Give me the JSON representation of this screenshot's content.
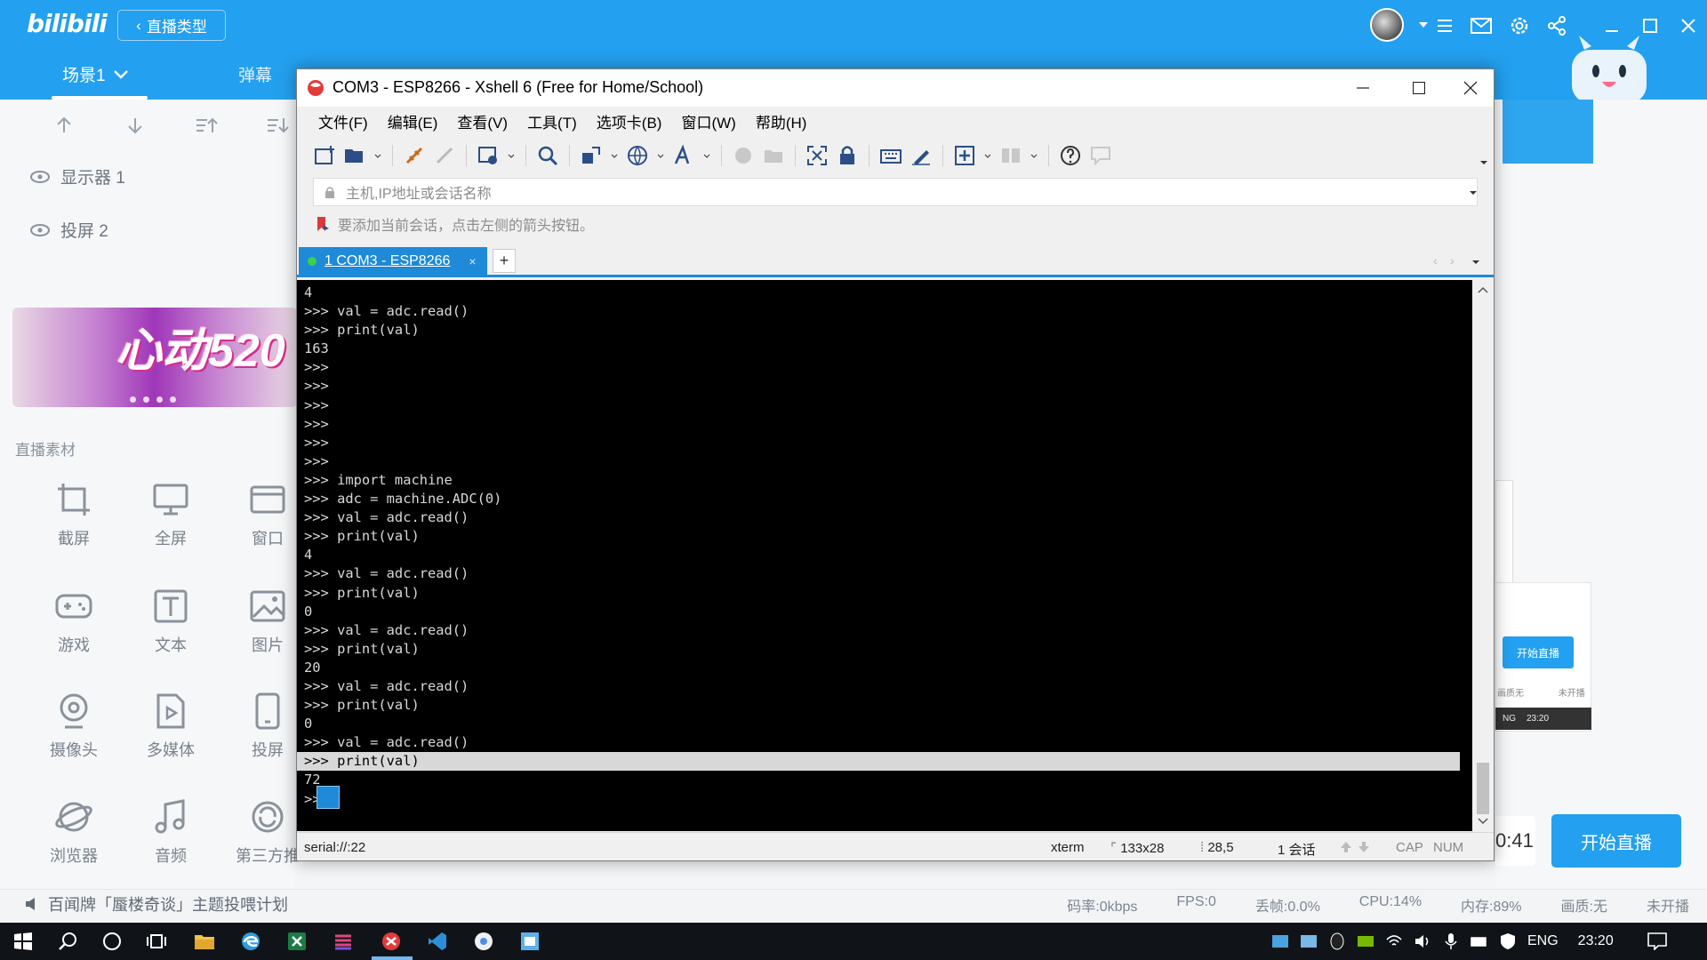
{
  "bili": {
    "logo": "bilibili",
    "live_type": "直播类型",
    "scene_tab": "场景1",
    "danmu_tab": "弹幕",
    "sources": [
      "显示器 1",
      "投屏 2"
    ],
    "banner_text": "心动520",
    "live_material_title": "直播素材",
    "materials": [
      "截屏",
      "全屏",
      "窗口",
      "游戏",
      "文本",
      "图片",
      "摄像头",
      "多媒体",
      "投屏",
      "浏览器",
      "音频",
      "第三方推"
    ],
    "timer": "0:41",
    "start_live": "开始直播",
    "mini_start_live": "开始直播",
    "mini_status": [
      "画质无",
      "未开播"
    ],
    "mini_bar": [
      "NG",
      "23:20"
    ],
    "notice": "百闻牌「蜃楼奇谈」主题投喂计划",
    "stats": [
      "码率:0kbps",
      "FPS:0",
      "丢帧:0.0%",
      "CPU:14%",
      "内存:89%",
      "画质:无",
      "未开播"
    ]
  },
  "xshell": {
    "title": "COM3 - ESP8266 - Xshell 6 (Free for Home/School)",
    "menu": [
      "文件(F)",
      "编辑(E)",
      "查看(V)",
      "工具(T)",
      "选项卡(B)",
      "窗口(W)",
      "帮助(H)"
    ],
    "address_placeholder": "主机,IP地址或会话名称",
    "hint": "要添加当前会话，点击左侧的箭头按钮。",
    "tab_label": "1 COM3 - ESP8266",
    "terminal_lines": [
      "4",
      ">>> val = adc.read()",
      ">>> print(val)",
      "163",
      ">>>",
      ">>>",
      ">>>",
      ">>>",
      ">>>",
      ">>>",
      ">>> import machine",
      ">>> adc = machine.ADC(0)",
      ">>> val = adc.read()",
      ">>> print(val)",
      "4",
      ">>> val = adc.read()",
      ">>> print(val)",
      "0",
      ">>> val = adc.read()",
      ">>> print(val)",
      "20",
      ">>> val = adc.read()",
      ">>> print(val)",
      "0",
      ">>> val = adc.read()"
    ],
    "highlight_line": ">>> print(val)",
    "after_lines": [
      "72",
      ">>"
    ],
    "status": {
      "connection": "serial://:22",
      "term_type": "xterm",
      "size": "133x28",
      "cursor_pos": "28,5",
      "sessions": "1 会话",
      "caps": "CAP",
      "num": "NUM"
    }
  },
  "taskbar": {
    "lang": "ENG",
    "clock": "23:20"
  }
}
